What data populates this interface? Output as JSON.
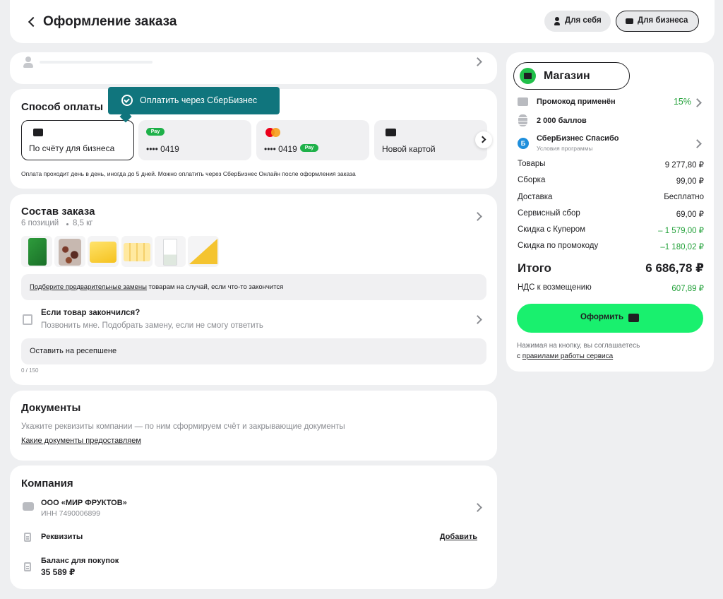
{
  "header": {
    "title": "Оформление заказа",
    "for_self": "Для себя",
    "for_business": "Для бизнеса"
  },
  "payment": {
    "title": "Способ оплаты",
    "tooltip": "Оплатить через СберБизнес",
    "tiles": [
      {
        "label": "По счёту для бизнеса"
      },
      {
        "label": "•••• 0419"
      },
      {
        "label": "•••• 0419"
      },
      {
        "label": "Новой картой"
      }
    ],
    "pay_badge": "Pay",
    "note": "Оплата проходит день в день, иногда до 5 дней. Можно оплатить через СберБизнес Онлайн после оформления заказа"
  },
  "order": {
    "title": "Состав заказа",
    "positions": "6 позиций",
    "weight": "8,5 кг",
    "replacements_link": "Подберите предварительные замены",
    "replacements_rest": " товарам на случай, если что-то закончится",
    "out_of_stock_title": "Если товар закончился?",
    "out_of_stock_sub": "Позвонить мне. Подобрать замену, если не смогу ответить",
    "comment": "Оставить на ресепшене",
    "counter": "0 / 150"
  },
  "documents": {
    "title": "Документы",
    "text": "Укажите реквизиты компании — по ним сформируем счёт и закрывающие документы",
    "link": "Какие документы предоставляем"
  },
  "company": {
    "title": "Компания",
    "name": "ООО «МИР ФРУКТОВ»",
    "inn": "ИНН 7490006899",
    "requisites": "Реквизиты",
    "add": "Добавить",
    "balance_label": "Баланс для покупок",
    "balance": "35 589 ₽"
  },
  "summary": {
    "store": "Магазин",
    "promo_label": "Промокод применён",
    "promo_value": "15%",
    "points": "2 000 баллов",
    "thanks_title": "СберБизнес Спасибо",
    "thanks_sub": "Условия программы",
    "thanks_badge": "Б",
    "rows": [
      {
        "label": "Товары",
        "value": "9 277,80 ₽"
      },
      {
        "label": "Сборка",
        "value": "99,00 ₽"
      },
      {
        "label": "Доставка",
        "value": "Бесплатно"
      },
      {
        "label": "Сервисный сбор",
        "value": "69,00 ₽"
      },
      {
        "label": "Скидка с Купером",
        "value": "– 1 579,00 ₽"
      },
      {
        "label": "Скидка по промокоду",
        "value": "–1 180,02 ₽"
      }
    ],
    "total_label": "Итого",
    "total_value": "6 686,78 ₽",
    "vat_label": "НДС к возмещению",
    "vat_value": "607,89 ₽",
    "submit": "Оформить",
    "agree_text": "Нажимая на кнопку, вы соглашаетесь",
    "agree_prefix": "с ",
    "agree_link": "правилами работы сервиса"
  },
  "colors": {
    "accent": "#21a038",
    "button": "#19f06e",
    "tooltip": "#10757d"
  }
}
